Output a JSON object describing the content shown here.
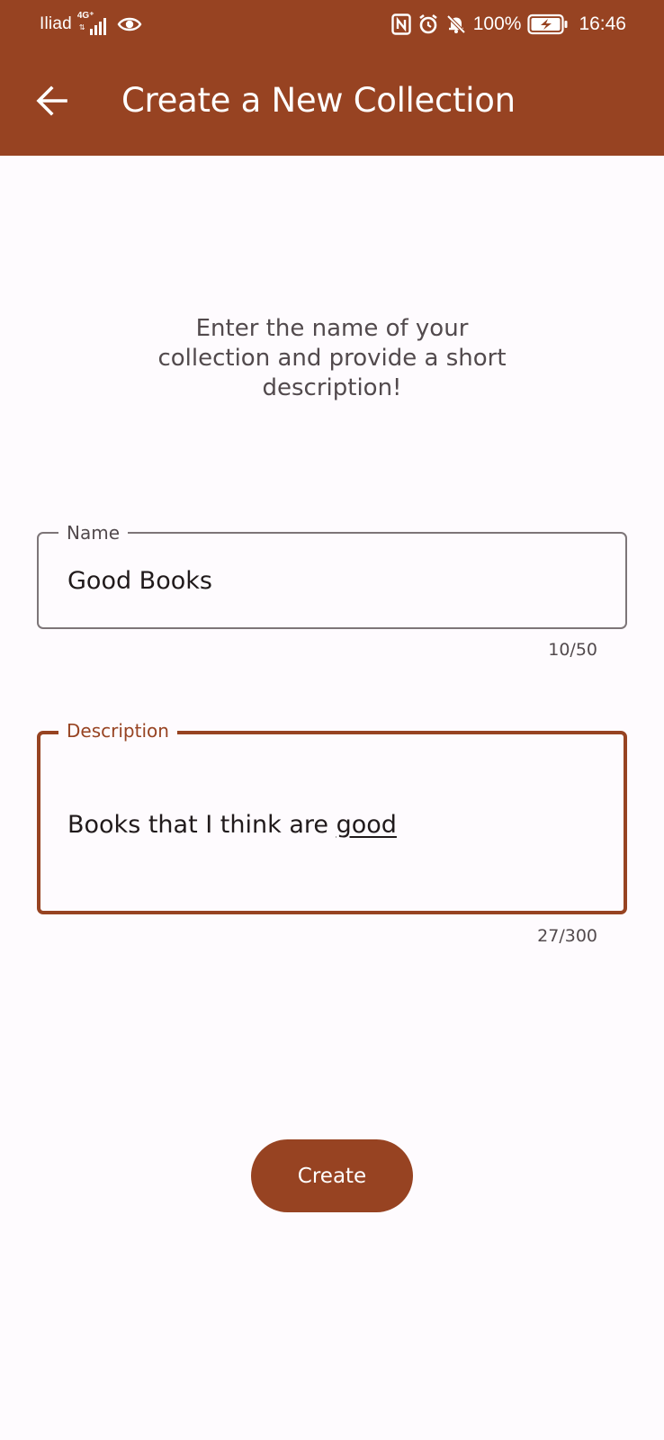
{
  "colors": {
    "primary": "#974322",
    "background": "#fefbfe",
    "on_primary": "#ffffff",
    "outline": "#7d7578",
    "text_secondary": "#524a4d"
  },
  "status_bar": {
    "carrier": "Iliad",
    "network_type": "4G⁺",
    "network_arrows": "⇅",
    "battery_percent": "100%",
    "time": "16:46",
    "icons": [
      "signal-bars-icon",
      "eye-icon",
      "nfc-icon",
      "alarm-icon",
      "bell-off-icon",
      "battery-charging-icon"
    ]
  },
  "app_bar": {
    "back_icon": "arrow-back-icon",
    "title": "Create a New Collection"
  },
  "intro": {
    "text": "Enter the name of your collection and provide a short description!"
  },
  "form": {
    "name": {
      "label": "Name",
      "value": "Good Books",
      "counter": "10/50"
    },
    "description": {
      "label": "Description",
      "value_prefix": "Books that I think are ",
      "value_underlined": "good",
      "counter": "27/300"
    }
  },
  "actions": {
    "create_label": "Create"
  }
}
